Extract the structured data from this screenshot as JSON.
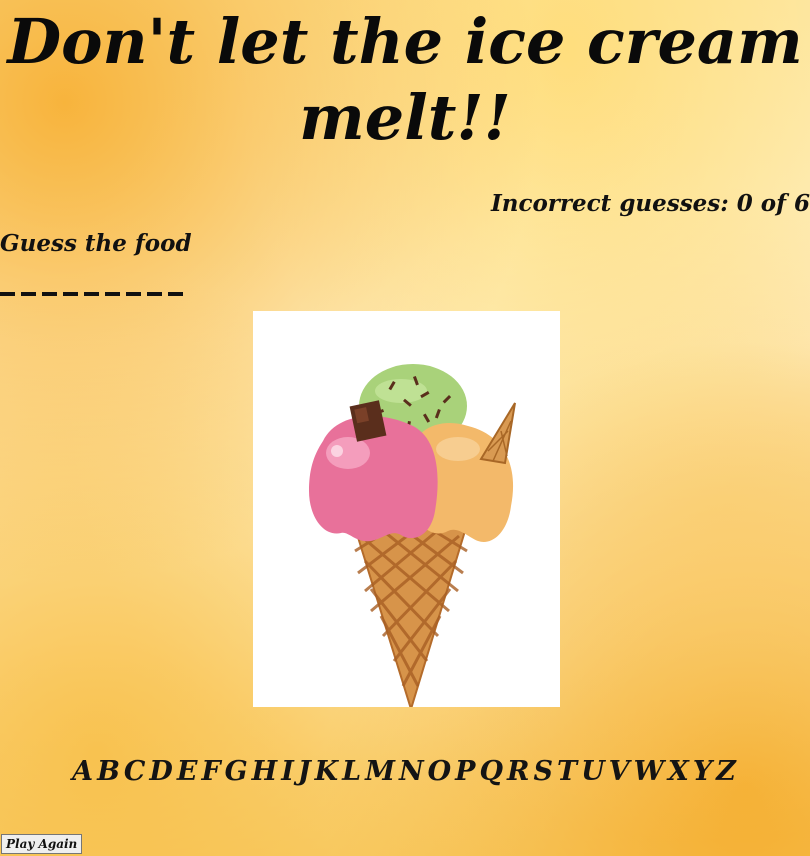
{
  "title": "Don't let the ice cream melt!!",
  "incorrect_guesses": "Incorrect guesses: 0 of 6",
  "guess_label": "Guess the food",
  "blanks_count": 9,
  "letters": [
    "A",
    "B",
    "C",
    "D",
    "E",
    "F",
    "G",
    "H",
    "I",
    "J",
    "K",
    "L",
    "M",
    "N",
    "O",
    "P",
    "Q",
    "R",
    "S",
    "T",
    "U",
    "V",
    "W",
    "X",
    "Y",
    "Z"
  ],
  "play_again_label": "Play Again",
  "image": {
    "icon": "ice-cream-cone-icon",
    "scoops": [
      "green",
      "pink",
      "orange"
    ],
    "colors": {
      "green_scoop": "#a9d27a",
      "pink_scoop": "#e8719a",
      "orange_scoop": "#f3b96a",
      "cone": "#d7944a",
      "chocolate": "#5a2e1c"
    }
  }
}
